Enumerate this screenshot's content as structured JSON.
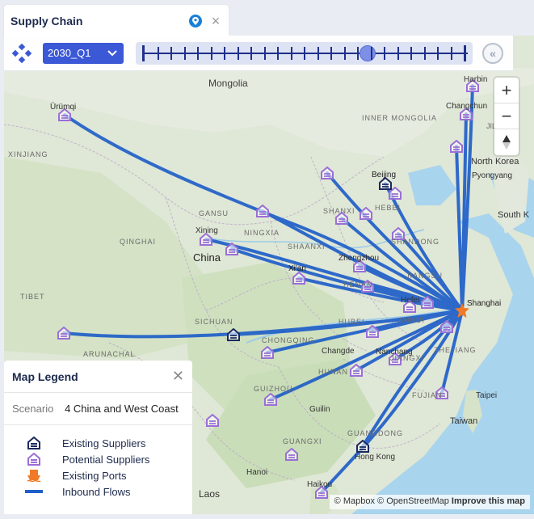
{
  "tab": {
    "title": "Supply Chain",
    "pin_icon": "location-pin-icon",
    "close_icon": "close-icon"
  },
  "toolbar": {
    "logo_icon": "diamond-network-icon",
    "period_value": "2030_Q1",
    "period_icon": "chevron-down-icon",
    "slider_ticks": 24,
    "slider_position_fraction": 0.7,
    "rewind_icon": "rewind-icon"
  },
  "map_controls": {
    "zoom_in": "+",
    "zoom_out": "−",
    "compass_icon": "compass-icon"
  },
  "map_labels": {
    "mongolia": "Mongolia",
    "inner_mongolia": "INNER MONGOLIA",
    "urumqi": "Ürümqi",
    "xinjiang": "XINJIANG",
    "beijing": "Beijing",
    "harbin": "Harbin",
    "jilin": "JILIN",
    "changchun": "Changchun",
    "north_korea": "North Korea",
    "pyongyang": "Pyongyang",
    "south_korea": "South K",
    "gansu": "GANSU",
    "ningxia": "NINGXIA",
    "shanxi": "SHANXI",
    "hebei": "HEBEI",
    "shandong": "SHANDONG",
    "qinghai": "QINGHAI",
    "xining": "Xining",
    "china": "China",
    "shaanxi": "SHAANXI",
    "zhengzhou": "Zhengzhou",
    "xian": "Xi'an",
    "henan": "HENAN",
    "jiangsu": "JIANGSU",
    "hefei": "Hefei",
    "shanghai": "Shanghai",
    "anhui": "ANHUI",
    "tibet": "TIBET",
    "sichuan": "SICHUAN",
    "hubei": "HUBEI",
    "chongqing": "CHONGQING",
    "zhejiang": "ZHEJIANG",
    "arunachal": "ARUNACHAL",
    "changde": "Changde",
    "nanchang": "Nanchang",
    "hunan": "HUNAN",
    "jiangxi": "JIANGXI",
    "guizhou": "GUIZHOU",
    "fujian": "FUJIAN",
    "taipei": "Taipei",
    "taiwan": "Taiwan",
    "guilin": "Guilin",
    "guangxi": "GUANGXI",
    "guangdong": "GUANGDONG",
    "hong_kong": "Hong Kong",
    "hanoi": "Hanoi",
    "laos": "Laos",
    "haikou": "Haikou"
  },
  "legend": {
    "title": "Map Legend",
    "close_icon": "close-icon",
    "scenario_label": "Scenario",
    "scenario_value": "4 China and West Coast",
    "items": [
      {
        "label": "Existing Suppliers",
        "icon": "existing-supplier-icon"
      },
      {
        "label": "Potential Suppliers",
        "icon": "potential-supplier-icon"
      },
      {
        "label": "Existing Ports",
        "icon": "port-icon"
      },
      {
        "label": "Inbound Flows",
        "icon": "flow-line-icon"
      }
    ]
  },
  "attribution": {
    "mapbox": "© Mapbox",
    "osm": "© OpenStreetMap",
    "improve": "Improve this map"
  },
  "colors": {
    "flow": "#1f5fc8",
    "existing_supplier": "#1c2a5c",
    "potential_supplier": "#9a6fd6",
    "port": "#f07a28",
    "land": "#dde6d3",
    "water": "#a9d4ee",
    "select": "#3b58d6"
  }
}
